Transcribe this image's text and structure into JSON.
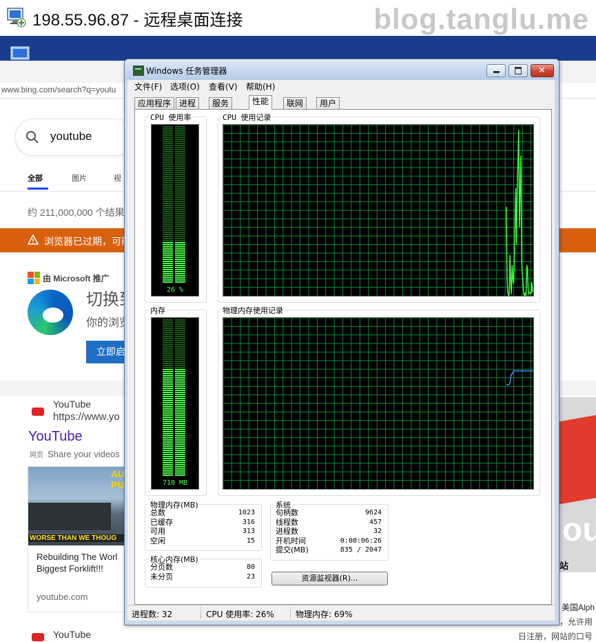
{
  "rdp": {
    "title": "198.55.96.87 - 远程桌面连接",
    "watermark": "blog.tanglu.me"
  },
  "browser": {
    "url": "www.bing.com/search?q=youtu",
    "search_query": "youtube",
    "tabs": [
      "全部",
      "图片",
      "视"
    ],
    "result_count": "约 211,000,000 个结果",
    "warning": "浏览器已过期，可能",
    "ad": {
      "label": "由 Microsoft 推广",
      "title": "切换到",
      "desc": "你的浏览",
      "button": "立即启"
    },
    "result1": {
      "site": "YouTube",
      "url": "https://www.yo",
      "title": "YouTube",
      "tag": "网页",
      "desc": "Share your videos",
      "video": {
        "thumb_text": "AU PUR",
        "thumb_caption": "WORSE THAN WE THOUG",
        "title_line1": "Rebuilding The Worl",
        "title_line2": "Biggest Forklift!!!",
        "domain": "youtube.com"
      }
    },
    "result2": {
      "site": "YouTube"
    },
    "right": {
      "big": "ou",
      "news": "站",
      "t1": "美国Alph",
      "t2": "，允许用",
      "t3": "日注册，网站的口号"
    }
  },
  "task_manager": {
    "title": "Windows 任务管理器",
    "menus": [
      "文件(F)",
      "选项(O)",
      "查看(V)",
      "帮助(H)"
    ],
    "tabs": [
      "应用程序",
      "进程",
      "服务",
      "性能",
      "联网",
      "用户"
    ],
    "active_tab": "性能",
    "cpu_usage_label": "CPU 使用率",
    "cpu_history_label": "CPU 使用记录",
    "mem_label": "内存",
    "mem_history_label": "物理内存使用记录",
    "cpu_meter_text": "26 %",
    "cpu_meter_fraction": 0.26,
    "mem_meter_text": "710 MB",
    "mem_meter_fraction": 0.69,
    "physical_memory": {
      "title": "物理内存(MB)",
      "rows": [
        {
          "label": "总数",
          "value": "1023"
        },
        {
          "label": "已缓存",
          "value": "316"
        },
        {
          "label": "可用",
          "value": "313"
        },
        {
          "label": "空闲",
          "value": "15"
        }
      ]
    },
    "kernel_memory": {
      "title": "核心内存(MB)",
      "rows": [
        {
          "label": "分页数",
          "value": "80"
        },
        {
          "label": "未分页",
          "value": "23"
        }
      ]
    },
    "system": {
      "title": "系统",
      "rows": [
        {
          "label": "句柄数",
          "value": "9624"
        },
        {
          "label": "线程数",
          "value": "457"
        },
        {
          "label": "进程数",
          "value": "32"
        },
        {
          "label": "开机时间",
          "value": "0:00:06:26"
        },
        {
          "label": "提交(MB)",
          "value": "835 / 2047"
        }
      ]
    },
    "resource_monitor_button": "资源监视器(R)...",
    "status": {
      "processes": "进程数: 32",
      "cpu": "CPU 使用率: 26%",
      "memory": "物理内存: 69%"
    },
    "colors": {
      "grid": "#0a8a3a",
      "cpu_line": "#3cff3c",
      "mem_line": "#3d8bff",
      "meter_on": "#4cff4c",
      "meter_off": "#1a5a1a"
    },
    "cpu_history": [
      0,
      0,
      0,
      0,
      0,
      0,
      0,
      0,
      0,
      0,
      0,
      0,
      0,
      0,
      0,
      0,
      0,
      0,
      0,
      0,
      0,
      0,
      0,
      0,
      0,
      0,
      0,
      0,
      0,
      0,
      0,
      0,
      0,
      0,
      0,
      0,
      0,
      0,
      0,
      0,
      0,
      0,
      0,
      0,
      0,
      0,
      0,
      0,
      0,
      0,
      0,
      0,
      0,
      0,
      0,
      0,
      0,
      0,
      0,
      0,
      0,
      0,
      0,
      0,
      0,
      0,
      0,
      0,
      0,
      0,
      0,
      0,
      0,
      0,
      0,
      0,
      0,
      0,
      0,
      0,
      0,
      0,
      0,
      0,
      0,
      0,
      0,
      0,
      0,
      0,
      0,
      0,
      0,
      0,
      0,
      0,
      0,
      0,
      0,
      0,
      0,
      0,
      0,
      0,
      0,
      0,
      0,
      0,
      0,
      0,
      0,
      0,
      0,
      0,
      0,
      0,
      0,
      0,
      0,
      0,
      0,
      0,
      0,
      0,
      0,
      0,
      0,
      0,
      0,
      0,
      0,
      0,
      0,
      0,
      0,
      0,
      0,
      0,
      0,
      0,
      0,
      0,
      0,
      0,
      0,
      0,
      0,
      0,
      0,
      0,
      0,
      0,
      0,
      0,
      0,
      0,
      0,
      0,
      0,
      0,
      0,
      0,
      0,
      0,
      0,
      0,
      0,
      0,
      0,
      0,
      0,
      0,
      0,
      0,
      0,
      0,
      0,
      0,
      0,
      0,
      0,
      0,
      0,
      0,
      0,
      0,
      0,
      0,
      0,
      0,
      0,
      0,
      0,
      0,
      0,
      0,
      0,
      0,
      0,
      0,
      0,
      0,
      0,
      0,
      0,
      0,
      0,
      0,
      0,
      0,
      0,
      0,
      0,
      0,
      0,
      0,
      0,
      0,
      0,
      0,
      0,
      0,
      0,
      0,
      0,
      0,
      0,
      0,
      0,
      0,
      0,
      0,
      0,
      0,
      0,
      0,
      0,
      0,
      0,
      0,
      0,
      0,
      0,
      0,
      0,
      0,
      0,
      0,
      0,
      0,
      0,
      0,
      0,
      0,
      0,
      0,
      0,
      0,
      0,
      0,
      0,
      0,
      0,
      0,
      0,
      0,
      0,
      0,
      0,
      0,
      0,
      0,
      0,
      0,
      0,
      0,
      0,
      0,
      0,
      0,
      0,
      0,
      0,
      0,
      0,
      0,
      0,
      0,
      0,
      0,
      0,
      0,
      0,
      0,
      0,
      0,
      0,
      0,
      0,
      0,
      0,
      0,
      0,
      0,
      0,
      0,
      0,
      0,
      0,
      0,
      0,
      0,
      0,
      0,
      0,
      0,
      0,
      0,
      0,
      0,
      0,
      0,
      0,
      0,
      0,
      0,
      0,
      0,
      0,
      0,
      0,
      0,
      0,
      0,
      0,
      0,
      0,
      0,
      0,
      0,
      0,
      0,
      0,
      0,
      0,
      0,
      0,
      0,
      0,
      0,
      0,
      0,
      0,
      0,
      0,
      0,
      0,
      0,
      0,
      0,
      0,
      0,
      0,
      0,
      0,
      0,
      0,
      0,
      0,
      0,
      0,
      0,
      0,
      0,
      0,
      0,
      0,
      0,
      0,
      0,
      0,
      0,
      0,
      0,
      0,
      0,
      0,
      0,
      52,
      10,
      2,
      0,
      1,
      24,
      8,
      1,
      18,
      10,
      7,
      20,
      44,
      63,
      30,
      62,
      80,
      97,
      40,
      62,
      82,
      20,
      12,
      7,
      1,
      0,
      2,
      0,
      18,
      16,
      3,
      1,
      2,
      2,
      1,
      8,
      3,
      2
    ],
    "mem_history": [
      0,
      0,
      0,
      0,
      0,
      0,
      0,
      0,
      0,
      0,
      0,
      0,
      0,
      0,
      0,
      0,
      0,
      0,
      0,
      0,
      0,
      0,
      0,
      0,
      0,
      0,
      0,
      0,
      0,
      0,
      0,
      0,
      0,
      0,
      0,
      0,
      0,
      0,
      0,
      0,
      0,
      0,
      0,
      0,
      0,
      0,
      0,
      0,
      0,
      0,
      0,
      0,
      0,
      0,
      0,
      0,
      0,
      0,
      0,
      0,
      0,
      0,
      0,
      0,
      0,
      0,
      0,
      0,
      0,
      0,
      0,
      0,
      0,
      0,
      0,
      0,
      0,
      0,
      0,
      0,
      0,
      0,
      0,
      0,
      0,
      0,
      0,
      0,
      0,
      0,
      0,
      0,
      0,
      0,
      0,
      0,
      0,
      0,
      0,
      0,
      0,
      0,
      0,
      0,
      0,
      0,
      0,
      0,
      0,
      0,
      0,
      0,
      0,
      0,
      0,
      0,
      0,
      0,
      0,
      0,
      0,
      0,
      0,
      0,
      0,
      0,
      0,
      0,
      0,
      0,
      0,
      0,
      0,
      0,
      0,
      0,
      0,
      0,
      0,
      0,
      0,
      0,
      0,
      0,
      0,
      0,
      0,
      0,
      0,
      0,
      0,
      0,
      0,
      0,
      0,
      0,
      0,
      0,
      0,
      0,
      0,
      0,
      0,
      0,
      0,
      0,
      0,
      0,
      0,
      0,
      0,
      0,
      0,
      0,
      0,
      0,
      0,
      0,
      0,
      0,
      0,
      0,
      0,
      0,
      0,
      0,
      0,
      0,
      0,
      0,
      0,
      0,
      0,
      0,
      0,
      0,
      0,
      0,
      0,
      0,
      0,
      0,
      0,
      0,
      0,
      0,
      0,
      0,
      0,
      0,
      0,
      0,
      0,
      0,
      0,
      0,
      0,
      0,
      0,
      0,
      0,
      0,
      0,
      0,
      0,
      0,
      0,
      0,
      0,
      0,
      0,
      0,
      0,
      0,
      0,
      0,
      0,
      0,
      0,
      0,
      0,
      0,
      0,
      0,
      0,
      0,
      0,
      0,
      0,
      0,
      0,
      0,
      0,
      0,
      0,
      0,
      0,
      0,
      0,
      0,
      0,
      0,
      0,
      0,
      0,
      0,
      0,
      0,
      0,
      0,
      0,
      0,
      0,
      0,
      0,
      0,
      0,
      0,
      0,
      0,
      0,
      0,
      0,
      0,
      0,
      0,
      0,
      0,
      0,
      0,
      0,
      0,
      0,
      0,
      0,
      0,
      0,
      0,
      0,
      0,
      0,
      0,
      0,
      0,
      0,
      0,
      0,
      0,
      0,
      0,
      0,
      0,
      0,
      0,
      0,
      0,
      0,
      0,
      0,
      0,
      0,
      0,
      0,
      0,
      0,
      0,
      0,
      0,
      0,
      0,
      0,
      0,
      0,
      0,
      0,
      0,
      0,
      0,
      0,
      0,
      0,
      0,
      0,
      0,
      0,
      0,
      0,
      0,
      0,
      0,
      0,
      0,
      0,
      0,
      0,
      0,
      0,
      0,
      0,
      0,
      0,
      0,
      0,
      0,
      0,
      0,
      0,
      0,
      0,
      0,
      0,
      0,
      0,
      0,
      0,
      0,
      0,
      0,
      0,
      0,
      0,
      0,
      0,
      0,
      0,
      0,
      0,
      0,
      0,
      0,
      0,
      0,
      0,
      0,
      0,
      0,
      0,
      0,
      0,
      0,
      61,
      61,
      61,
      61,
      61,
      62,
      65,
      67,
      67,
      68,
      69,
      69,
      69,
      69,
      69,
      69,
      69,
      69,
      69,
      69,
      69,
      69,
      69,
      69,
      69,
      69,
      69,
      69,
      69,
      69,
      69,
      69,
      69,
      69,
      69,
      69,
      69,
      69,
      69
    ]
  }
}
